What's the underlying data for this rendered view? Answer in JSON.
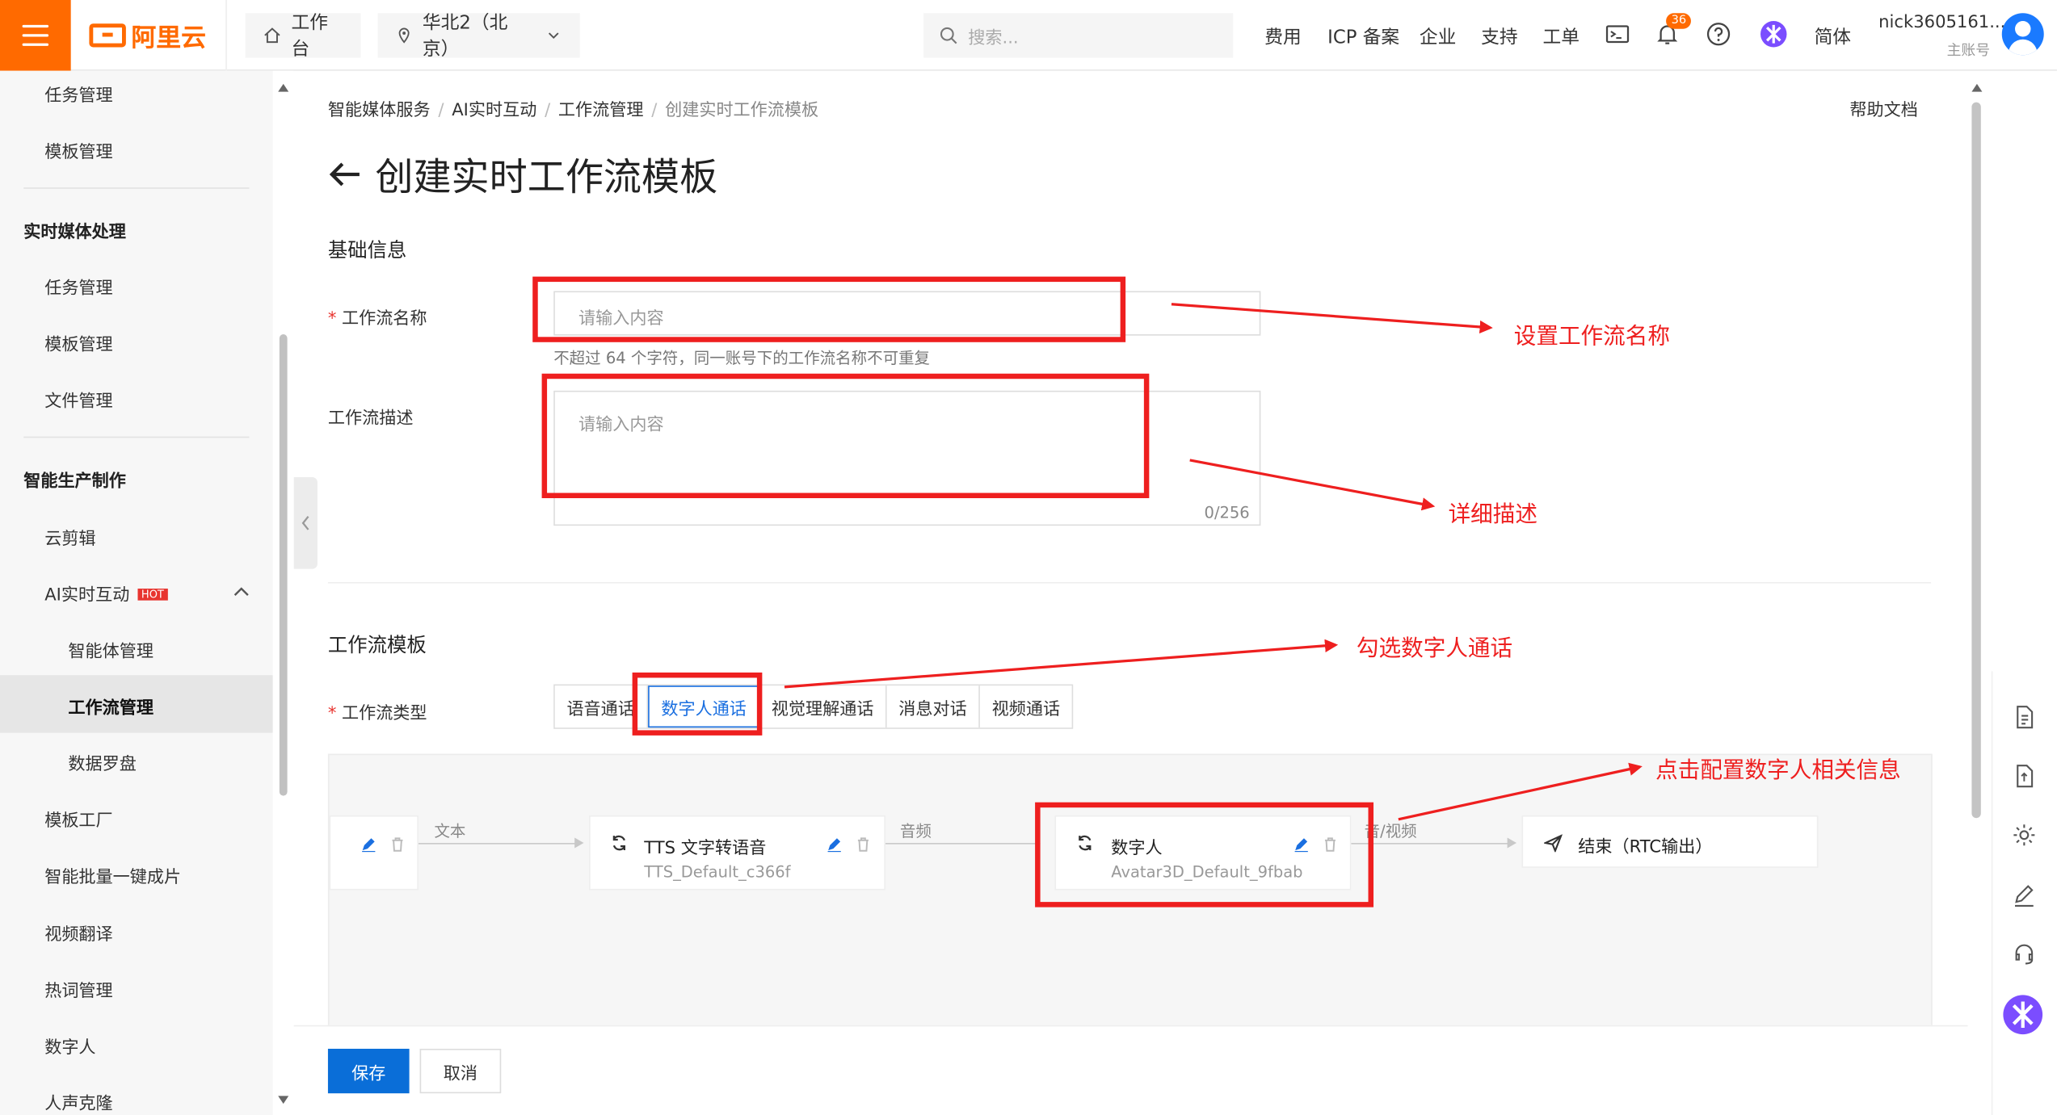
{
  "topbar": {
    "brand": "阿里云",
    "workbench": "工作台",
    "region": "华北2（北京）",
    "search_placeholder": "搜索...",
    "links": [
      "费用",
      "ICP 备案",
      "企业",
      "支持",
      "工单"
    ],
    "notification_count": "36",
    "language": "简体",
    "user_name": "nick3605161...",
    "user_role": "主账号"
  },
  "sidebar": {
    "items_top": [
      "任务管理",
      "模板管理"
    ],
    "group_realtime": "实时媒体处理",
    "realtime_items": [
      "任务管理",
      "模板管理",
      "文件管理"
    ],
    "group_production": "智能生产制作",
    "production_items": [
      "云剪辑"
    ],
    "ai_interaction": "AI实时互动",
    "hot_badge": "HOT",
    "ai_sub_items": [
      "智能体管理",
      "工作流管理",
      "数据罗盘"
    ],
    "more_items": [
      "模板工厂",
      "智能批量一键成片",
      "视频翻译",
      "热词管理",
      "数字人",
      "人声克隆"
    ]
  },
  "breadcrumb": [
    "智能媒体服务",
    "AI实时互动",
    "工作流管理",
    "创建实时工作流模板"
  ],
  "help_link": "帮助文档",
  "page_title": "创建实时工作流模板",
  "basic": {
    "section_title": "基础信息",
    "name_label": "工作流名称",
    "name_placeholder": "请输入内容",
    "name_hint": "不超过 64 个字符，同一账号下的工作流名称不可重复",
    "desc_label": "工作流描述",
    "desc_placeholder": "请输入内容",
    "desc_counter": "0/256"
  },
  "template": {
    "section_title": "工作流模板",
    "type_label": "工作流类型",
    "types": [
      "语音通话",
      "数字人通话",
      "视觉理解通话",
      "消息对话",
      "视频通话"
    ],
    "selected_type": "数字人通话"
  },
  "flow": {
    "edge1_label": "文本",
    "tts_title": "TTS 文字转语音",
    "tts_sub": "TTS_Default_c366f",
    "edge2_label": "音频",
    "avatar_title": "数字人",
    "avatar_sub": "Avatar3D_Default_9fbab",
    "edge3_label": "音/视频",
    "end_title": "结束（RTC输出）"
  },
  "footer": {
    "save": "保存",
    "cancel": "取消"
  },
  "annotations": {
    "name": "设置工作流名称",
    "desc": "详细描述",
    "type": "勾选数字人通话",
    "avatar": "点击配置数字人相关信息",
    "color": "#ee1f1f"
  }
}
